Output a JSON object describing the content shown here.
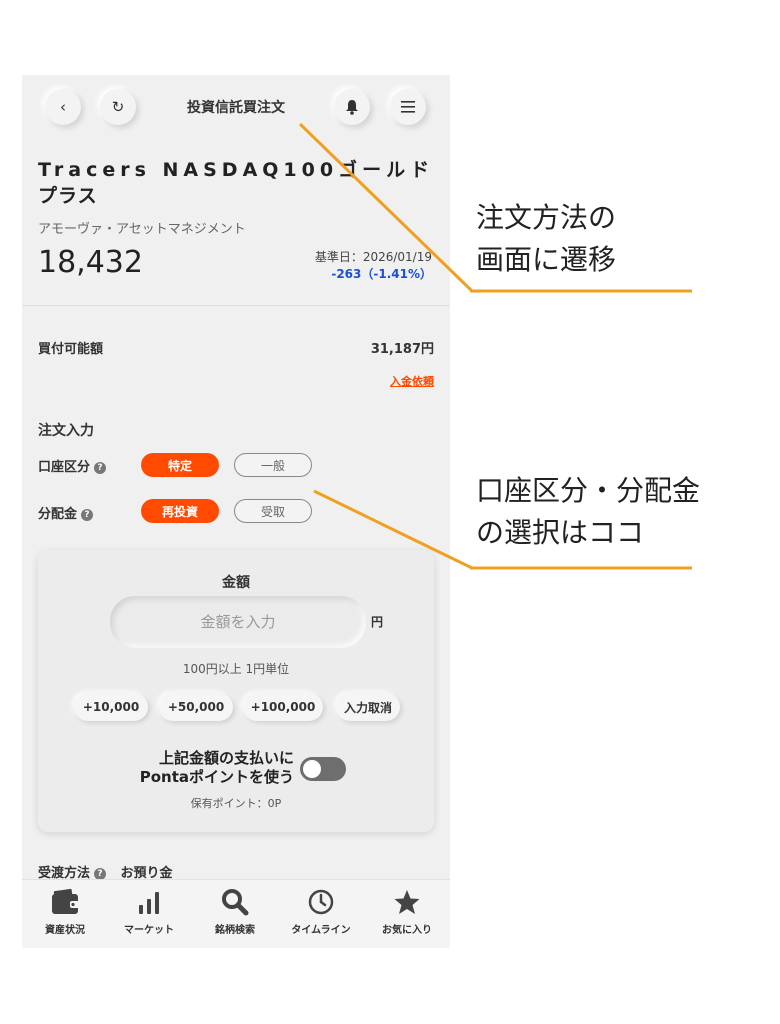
{
  "header": {
    "title": "投資信託買注文"
  },
  "fund": {
    "name_line1": "Tracers NASDAQ100ゴールド",
    "name_line2": "プラス",
    "company": "アモーヴァ・アセットマネジメント",
    "price": "18,432",
    "base_date": "基準日：2026/01/19",
    "change": "-263（-1.41%）"
  },
  "buying_power": {
    "label": "買付可能額",
    "value": "31,187円",
    "deposit_link": "入金依頼"
  },
  "order_input": {
    "title": "注文入力",
    "account_label": "口座区分",
    "account_options": [
      "特定",
      "一般"
    ],
    "distribution_label": "分配金",
    "distribution_options": [
      "再投資",
      "受取"
    ]
  },
  "amount_card": {
    "title": "金額",
    "placeholder": "金額を入力",
    "unit": "円",
    "hint": "100円以上 1円単位",
    "quick_buttons": [
      "+10,000",
      "+50,000",
      "+100,000",
      "入力取消"
    ],
    "ponta_line1": "上記金額の支払いに",
    "ponta_line2": "Pontaポイントを使う",
    "ponta_enabled": false,
    "points": "保有ポイント：0P"
  },
  "settlement": {
    "label": "受渡方法",
    "value": "お預り金"
  },
  "bottom_nav": [
    {
      "label": "資産状況",
      "icon": "wallet-icon"
    },
    {
      "label": "マーケット",
      "icon": "bar-chart-icon"
    },
    {
      "label": "銘柄検索",
      "icon": "search-icon"
    },
    {
      "label": "タイムライン",
      "icon": "clock-icon"
    },
    {
      "label": "お気に入り",
      "icon": "star-icon"
    }
  ],
  "annotations": {
    "a1_line1": "注文方法の",
    "a1_line2": "画面に遷移",
    "a2_line1": "口座区分・分配金",
    "a2_line2": "の選択はココ"
  },
  "colors": {
    "accent": "#ff4a00",
    "change_negative": "#1a4fd8",
    "annotation_line": "#f0a020"
  }
}
